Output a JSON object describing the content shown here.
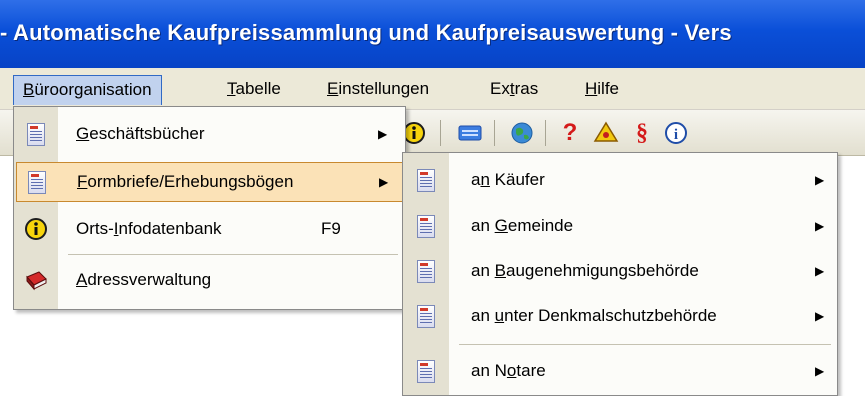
{
  "window": {
    "title": "- Automatische Kaufpreissammlung und Kaufpreisauswertung - Vers"
  },
  "menubar": {
    "items": [
      {
        "pre": "",
        "u": "B",
        "post": "üroorganisation"
      },
      {
        "pre": "",
        "u": "T",
        "post": "abelle"
      },
      {
        "pre": "",
        "u": "E",
        "post": "instellungen"
      },
      {
        "pre": "Ex",
        "u": "t",
        "post": "ras"
      },
      {
        "pre": "",
        "u": "H",
        "post": "ilfe"
      }
    ]
  },
  "toolbar": {
    "icons": [
      "info-icon",
      "keyboard-icon",
      "globe-icon",
      "help-icon",
      "law-icon",
      "paragraph-icon",
      "about-icon"
    ],
    "glyphs": {
      "help": "?",
      "paragraph": "§",
      "about": "i"
    }
  },
  "menu_buero": {
    "items": [
      {
        "pre": "",
        "u": "G",
        "post": "eschäftsbücher",
        "shortcut": "",
        "submenu": "▶"
      },
      {
        "pre": "",
        "u": "F",
        "post": "ormbriefe/Erhebungsbögen",
        "shortcut": "",
        "submenu": "▶"
      },
      {
        "pre": "Orts-",
        "u": "I",
        "post": "nfodatenbank",
        "shortcut": "F9",
        "submenu": ""
      },
      {
        "pre": "",
        "u": "A",
        "post": "dressverwaltung",
        "shortcut": "",
        "submenu": ""
      }
    ]
  },
  "menu_formbriefe": {
    "items": [
      {
        "pre": "a",
        "u": "n",
        "post": " Käufer",
        "submenu": "▶"
      },
      {
        "pre": "an ",
        "u": "G",
        "post": "emeinde",
        "submenu": "▶"
      },
      {
        "pre": "an ",
        "u": "B",
        "post": "augenehmigungsbehörde",
        "submenu": "▶"
      },
      {
        "pre": "an ",
        "u": "u",
        "post": "nter Denkmalschutzbehörde",
        "submenu": "▶"
      },
      {
        "pre": "an N",
        "u": "o",
        "post": "tare",
        "submenu": "▶"
      }
    ]
  },
  "colors": {
    "titlebar": "#0a4fd8",
    "highlight": "#fbe2b7",
    "menu_open": "#c1d2ee"
  }
}
